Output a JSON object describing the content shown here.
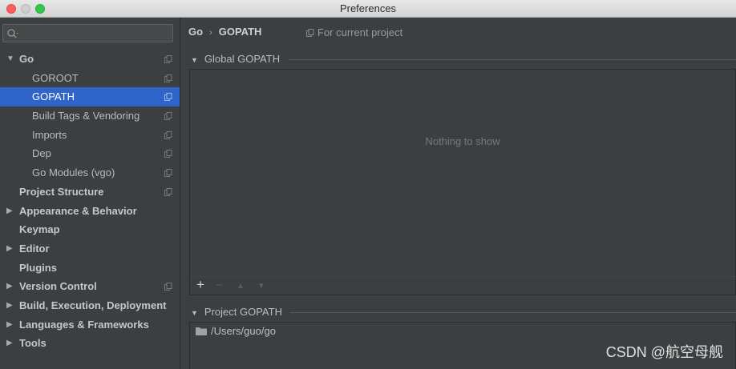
{
  "window": {
    "title": "Preferences"
  },
  "sidebar": {
    "search": {
      "placeholder": "",
      "value": ""
    },
    "items": [
      {
        "label": "Go",
        "expanded": true,
        "bold": true
      },
      {
        "label": "GOROOT"
      },
      {
        "label": "GOPATH",
        "selected": true
      },
      {
        "label": "Build Tags & Vendoring"
      },
      {
        "label": "Imports"
      },
      {
        "label": "Dep"
      },
      {
        "label": "Go Modules (vgo)"
      },
      {
        "label": "Project Structure"
      },
      {
        "label": "Appearance & Behavior"
      },
      {
        "label": "Keymap"
      },
      {
        "label": "Editor"
      },
      {
        "label": "Plugins"
      },
      {
        "label": "Version Control"
      },
      {
        "label": "Build, Execution, Deployment"
      },
      {
        "label": "Languages & Frameworks"
      },
      {
        "label": "Tools"
      }
    ]
  },
  "main": {
    "breadcrumb": {
      "parent": "Go",
      "separator": "›",
      "current": "GOPATH"
    },
    "scope_label": "For current project",
    "global_section": {
      "title": "Global GOPATH",
      "empty_text": "Nothing to show"
    },
    "project_section": {
      "title": "Project GOPATH",
      "paths": [
        "/Users/guo/go"
      ]
    },
    "toolbar": {
      "add": "+",
      "remove": "−",
      "up": "▲",
      "down": "▼"
    }
  },
  "watermark": "CSDN @航空母舰",
  "colors": {
    "selection": "#2f65ca",
    "background": "#3c3f41"
  }
}
